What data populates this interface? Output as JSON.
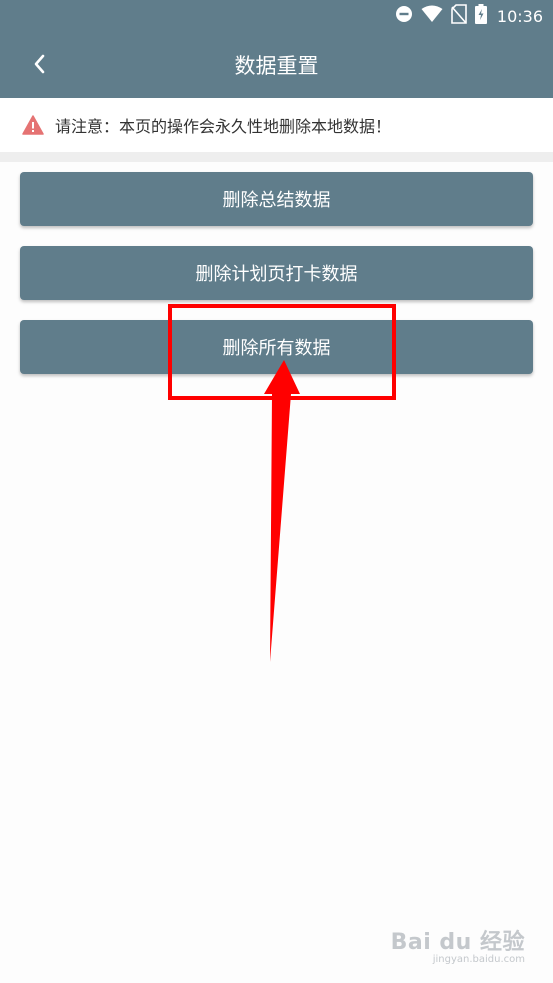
{
  "status_bar": {
    "time": "10:36"
  },
  "header": {
    "title": "数据重置",
    "back_icon": "chevron-left-icon"
  },
  "warning": {
    "text": "请注意：本页的操作会永久性地删除本地数据！",
    "icon": "warning-triangle-icon",
    "icon_color": "#e57373"
  },
  "buttons": [
    {
      "label": "删除总结数据"
    },
    {
      "label": "删除计划页打卡数据"
    },
    {
      "label": "删除所有数据"
    }
  ],
  "colors": {
    "primary": "#607d8b",
    "annotation": "#ff0000"
  },
  "watermark": {
    "logo": "Bai du 经验",
    "url": "jingyan.baidu.com"
  }
}
